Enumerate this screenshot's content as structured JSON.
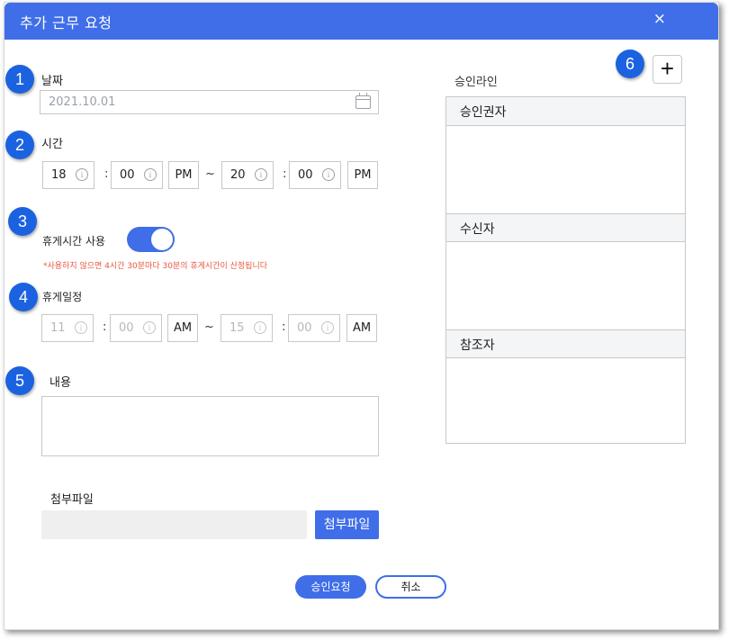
{
  "dialog": {
    "title": "추가 근무 요청",
    "close_glyph": "×"
  },
  "badges": [
    "1",
    "2",
    "3",
    "4",
    "5",
    "6"
  ],
  "date": {
    "label": "날짜",
    "value": "2021.10.01",
    "icon": "calendar-icon"
  },
  "time": {
    "label": "시간",
    "start_hour": "18",
    "start_minute": "00",
    "start_ampm": "PM",
    "range_sep": "~",
    "colon": ":",
    "end_hour": "20",
    "end_minute": "00",
    "end_ampm": "PM",
    "info_glyph": "i"
  },
  "break_toggle": {
    "label": "휴게시간 사용",
    "state": "on",
    "warning": "*사용하지 않으면 4시간 30분마다 30분의 휴게시간이 산정됩니다"
  },
  "break_schedule": {
    "label": "휴게일정",
    "start_hour": "11",
    "start_minute": "00",
    "start_ampm": "AM",
    "end_hour": "15",
    "end_minute": "00",
    "end_ampm": "AM"
  },
  "content": {
    "label": "내용",
    "value": ""
  },
  "attachment": {
    "label": "첨부파일",
    "button_label": "첨부파일"
  },
  "actions": {
    "approve_label": "승인요청",
    "cancel_label": "취소"
  },
  "approval_line": {
    "title": "승인라인",
    "add_glyph": "+",
    "sections": [
      "승인권자",
      "수신자",
      "참조자"
    ]
  },
  "colors": {
    "accent": "#3f6ee8",
    "badge": "#1b62e0",
    "warning": "#e9573f"
  }
}
